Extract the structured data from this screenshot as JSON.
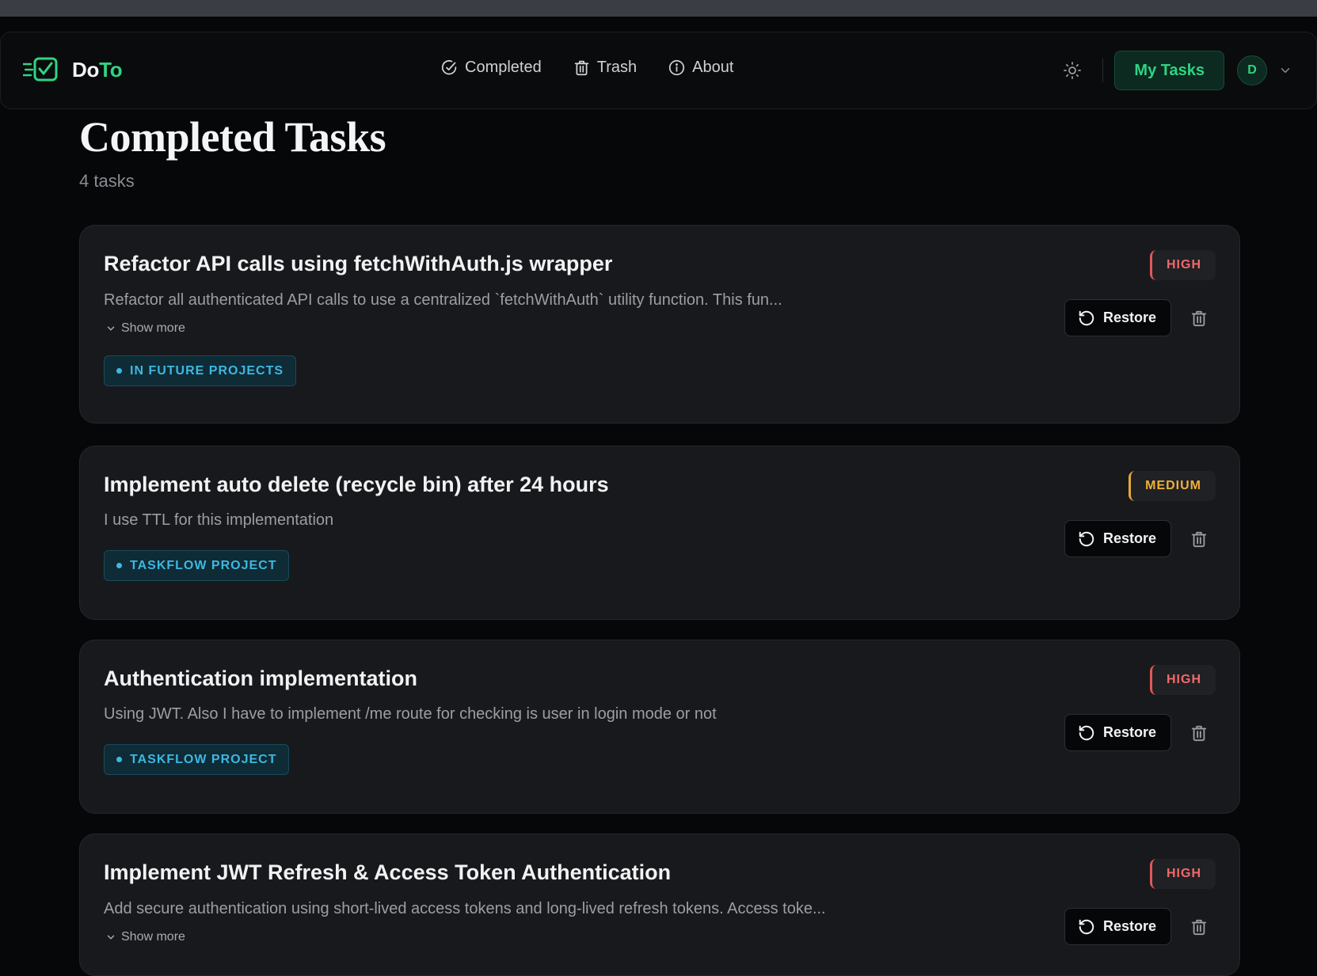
{
  "brand": {
    "name_part1": "Do",
    "name_part2": "To"
  },
  "nav": {
    "completed": "Completed",
    "trash": "Trash",
    "about": "About"
  },
  "header": {
    "my_tasks_label": "My Tasks",
    "avatar_initial": "D"
  },
  "page": {
    "title": "Completed Tasks",
    "count": "4 tasks"
  },
  "labels": {
    "restore": "Restore",
    "show_more": "Show more"
  },
  "colors": {
    "accent": "#2fd483",
    "high": "#f06a6a",
    "medium": "#f0b03a",
    "tag": "#3db8e0"
  },
  "tasks": [
    {
      "title": "Refactor API calls using fetchWithAuth.js wrapper",
      "description": "Refactor all authenticated API calls to use a centralized `fetchWithAuth` utility function. This fun...",
      "show_more": true,
      "tag": "IN FUTURE PROJECTS",
      "priority": "HIGH"
    },
    {
      "title": "Implement auto delete (recycle bin) after 24 hours",
      "description": "I use TTL for this implementation",
      "show_more": false,
      "tag": "TASKFLOW PROJECT",
      "priority": "MEDIUM"
    },
    {
      "title": "Authentication implementation",
      "description": "Using JWT. Also I have to implement /me route for checking is user in login mode or not",
      "show_more": false,
      "tag": "TASKFLOW PROJECT",
      "priority": "HIGH"
    },
    {
      "title": "Implement JWT Refresh & Access Token Authentication",
      "description": "Add secure authentication using short-lived access tokens and long-lived refresh tokens. Access toke...",
      "show_more": true,
      "tag": "",
      "priority": "HIGH"
    }
  ]
}
